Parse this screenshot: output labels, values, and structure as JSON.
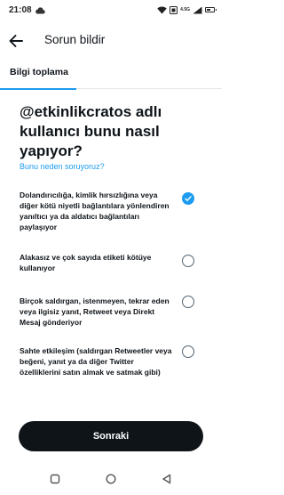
{
  "status_bar": {
    "time": "21:08",
    "network_label": "4.5G",
    "battery_level": 0.6
  },
  "header": {
    "title": "Sorun bildir",
    "back_icon": "arrow-left-icon"
  },
  "tabs": [
    {
      "label": "Bilgi toplama",
      "active": true
    }
  ],
  "question": "@etkinlikcratos adlı kullanıcı bunu nasıl yapıyor?",
  "why_link": "Bunu neden soruyoruz?",
  "options": [
    {
      "text": "Dolandırıcılığa, kimlik hırsızlığına veya diğer kötü niyetli bağlantılara yönlendiren yanıltıcı ya da aldatıcı bağlantıları paylaşıyor",
      "selected": true
    },
    {
      "text": "Alakasız ve çok sayıda etiketi kötüye kullanıyor",
      "selected": false
    },
    {
      "text": "Birçok saldırgan, istenmeyen, tekrar eden veya ilgisiz yanıt, Retweet veya Direkt Mesaj gönderiyor",
      "selected": false
    },
    {
      "text": "Sahte etkileşim (saldırgan Retweetler veya beğeni, yanıt ya da diğer Twitter özelliklerini satın almak ve satmak gibi)",
      "selected": false
    }
  ],
  "next_button": "Sonraki",
  "colors": {
    "accent": "#1d9bf0",
    "text": "#0f1419",
    "button_bg": "#0f1419"
  },
  "nav": {
    "recents_icon": "square-icon",
    "home_icon": "circle-icon",
    "back_icon": "triangle-back-icon"
  }
}
